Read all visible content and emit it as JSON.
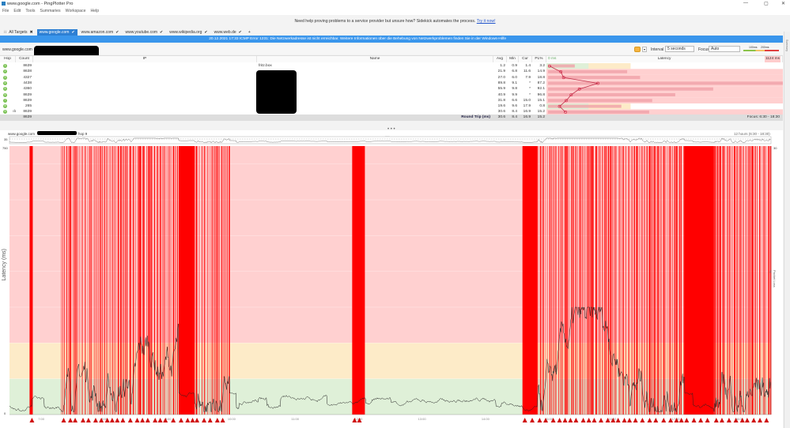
{
  "window": {
    "title": "www.google.com - PingPlotter Pro",
    "controls": [
      "—",
      "▢",
      "✕"
    ]
  },
  "menu": [
    "File",
    "Edit",
    "Tools",
    "Summaries",
    "Workspace",
    "Help"
  ],
  "promo": {
    "text": "Need help proving problems to a service provider but unsure how? Sidekick automates the process.",
    "link": "Try it now!"
  },
  "tabs": [
    {
      "label": "All Targets",
      "icon": "grid-icon",
      "mark": "✖"
    },
    {
      "label": "www.google.com",
      "mark": "✔",
      "active": true
    },
    {
      "label": "www.amazon.com",
      "mark": "✔"
    },
    {
      "label": "www.youtube.com",
      "mark": "✔"
    },
    {
      "label": "www.wikipedia.org",
      "mark": "✔"
    },
    {
      "label": "www.web.de",
      "mark": "✔"
    },
    {
      "label": "+",
      "mark": ""
    }
  ],
  "banner": "20.12.2021 17:33 ICMP Error 1231: Die Netzwerkadresse ist nicht erreichbar. Weitere Informationen über die Behebung von Netzwerkproblemen finden Sie in der Windows-Hilfe",
  "target": {
    "name": "www.google.com",
    "interval_label": "Interval",
    "interval": "5 seconds",
    "focus_label": "Focus",
    "focus": "Auto",
    "legend_100": "100ms",
    "legend_200": "200ms",
    "side_tab": "Summary"
  },
  "table": {
    "headers": {
      "hop": "Hop",
      "count": "Count",
      "ip": "IP",
      "name": "Name",
      "avg": "Avg",
      "min": "Min",
      "cur": "Cur",
      "pl": "PL%",
      "pl_scale": "0 ms",
      "latency": "Latency",
      "latency_max": "1124 ms"
    },
    "rows": [
      {
        "hop": "1",
        "count": "8639",
        "name": "fritz.box",
        "avg": "1.2",
        "min": "0.9",
        "cur": "1.4",
        "pl": "3.2"
      },
      {
        "hop": "2",
        "count": "8638",
        "name": "",
        "avg": "21.9",
        "min": "6.8",
        "cur": "11.6",
        "pl": "14.9"
      },
      {
        "hop": "3",
        "count": "4327",
        "name": "",
        "avg": "27.0",
        "min": "6.0",
        "cur": "7.9",
        "pl": "18.8"
      },
      {
        "hop": "4",
        "count": "4438",
        "name": "",
        "avg": "89.8",
        "min": "9.1",
        "cur": "*",
        "pl": "87.2"
      },
      {
        "hop": "5",
        "count": "4360",
        "name": "",
        "avg": "55.9",
        "min": "9.8",
        "cur": "*",
        "pl": "92.1"
      },
      {
        "hop": "6",
        "count": "8639",
        "name": "",
        "avg": "40.9",
        "min": "9.9",
        "cur": "*",
        "pl": "96.8"
      },
      {
        "hop": "7",
        "count": "8639",
        "name": "",
        "avg": "31.8",
        "min": "6.6",
        "cur": "15.0",
        "pl": "15.1"
      },
      {
        "hop": "8",
        "count": "265",
        "name": "",
        "avg": "19.6",
        "min": "9.6",
        "cur": "17.9",
        "pl": "0.8"
      },
      {
        "hop": "9",
        "count": "8639",
        "name": "www.google.com",
        "avg": "30.6",
        "min": "8.4",
        "cur": "16.9",
        "pl": "15.2",
        "flag": "ılı"
      }
    ],
    "summary": {
      "count": "8639",
      "label": "Round Trip (ms)",
      "avg": "30.6",
      "min": "8.4",
      "cur": "16.9",
      "pl": "15.2",
      "focus": "Focus: 6:30 - 18:30"
    }
  },
  "graph": {
    "target": "www.google.com",
    "hop": "hop 9",
    "overview_left": "35",
    "overview_mid": "350 ms",
    "range": "12 hours (6:30 - 18:30)",
    "y_left_label": "Latency (ms)",
    "y_right_label": "Packet Loss %",
    "y_max": "750",
    "y_min": "0",
    "pl_max": "30",
    "colors": {
      "good": "#dff0d8",
      "warn": "#fdebc8",
      "bad": "#ffd0d0",
      "loss": "#ff0000",
      "line": "#222222"
    },
    "thresholds_ms": [
      100,
      200
    ],
    "gridlines_ms": [
      100,
      200,
      300,
      400,
      500,
      600,
      700
    ],
    "time_start": "6:30",
    "time_end": "18:30",
    "time_ticks": [
      "7:00",
      "8:00",
      "9:00",
      "10:00",
      "11:00",
      "12:00",
      "13:00",
      "14:00",
      "15:00",
      "16:00",
      "17:00",
      "18:00"
    ],
    "loss_blocks": [
      [
        "6:49",
        "6:52"
      ],
      [
        "9:10",
        "9:25"
      ],
      [
        "11:54",
        "12:06"
      ],
      [
        "14:35",
        "14:49"
      ],
      [
        "17:08",
        "17:36"
      ]
    ],
    "loss_clusters": [
      [
        "7:19",
        "9:10"
      ],
      [
        "9:25",
        "9:58"
      ],
      [
        "14:49",
        "17:08"
      ],
      [
        "17:36",
        "18:30"
      ]
    ]
  }
}
